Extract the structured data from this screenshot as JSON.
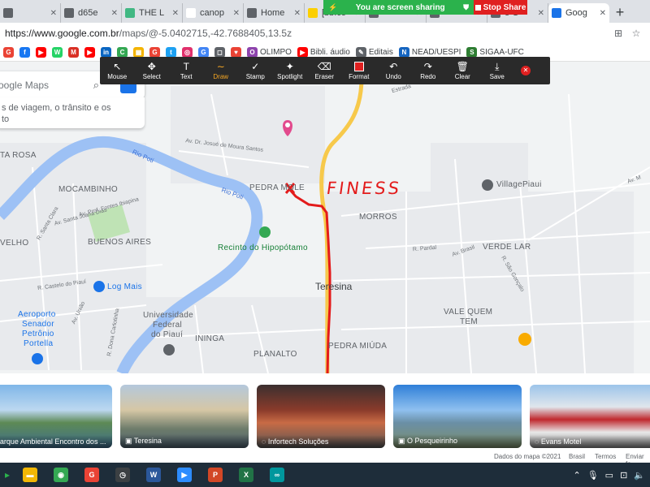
{
  "browser": {
    "tabs": [
      {
        "label": "",
        "fav": "x",
        "favColor": "#5f6368"
      },
      {
        "label": "d65e",
        "fav": "globe",
        "favColor": "#5f6368"
      },
      {
        "label": "THE L",
        "fav": "V",
        "favColor": "#41b883"
      },
      {
        "label": "canop",
        "fav": "G",
        "favColor": "#ffffff"
      },
      {
        "label": "Home",
        "fav": "hand",
        "favColor": "#5f6368"
      },
      {
        "label": "[bb.co",
        "fav": "bb",
        "favColor": "#fccf00"
      },
      {
        "label": "",
        "fav": "globe",
        "favColor": "#5f6368"
      },
      {
        "label": "",
        "fav": "globe",
        "favColor": "#5f6368"
      },
      {
        "label": "e G",
        "fav": "",
        "favColor": "#5f6368"
      },
      {
        "label": "Goog",
        "fav": "pin",
        "favColor": "#1a73e8",
        "active": true
      }
    ],
    "new_tab": "+",
    "url_host": "https://www.google.com.br",
    "url_rest": "/maps/@-5.0402715,-42.7688405,13.5z",
    "bookmarks": [
      {
        "label": "",
        "icon": "G",
        "color": "#ea4335"
      },
      {
        "label": "",
        "icon": "f",
        "color": "#1877f2"
      },
      {
        "label": "",
        "icon": "▶",
        "color": "#ff0000"
      },
      {
        "label": "",
        "icon": "W",
        "color": "#25d366"
      },
      {
        "label": "",
        "icon": "M",
        "color": "#d93025"
      },
      {
        "label": "",
        "icon": "▶",
        "color": "#ff0000"
      },
      {
        "label": "",
        "icon": "in",
        "color": "#0a66c2"
      },
      {
        "label": "",
        "icon": "C",
        "color": "#34a853"
      },
      {
        "label": "",
        "icon": "▦",
        "color": "#f4b400"
      },
      {
        "label": "",
        "icon": "G",
        "color": "#ea4335"
      },
      {
        "label": "",
        "icon": "t",
        "color": "#1da1f2"
      },
      {
        "label": "",
        "icon": "◎",
        "color": "#e1306c"
      },
      {
        "label": "",
        "icon": "G",
        "color": "#4285f4"
      },
      {
        "label": "",
        "icon": "◻",
        "color": "#5f6368"
      },
      {
        "label": "",
        "icon": "♥",
        "color": "#ea4335"
      },
      {
        "label": "OLIMPO",
        "icon": "O",
        "color": "#8e44ad"
      },
      {
        "label": "Bibli. áudio",
        "icon": "▶",
        "color": "#ff0000"
      },
      {
        "label": "Editais",
        "icon": "✎",
        "color": "#5f6368"
      },
      {
        "label": "NEAD/UESPI",
        "icon": "N",
        "color": "#1565c0"
      },
      {
        "label": "SIGAA-UFC",
        "icon": "S",
        "color": "#2e7d32"
      }
    ]
  },
  "share_banner": {
    "sharing_text": "You are screen sharing",
    "stop_label": "Stop Share"
  },
  "zoom_toolbar": {
    "tools": [
      {
        "label": "Mouse",
        "icon": "↖"
      },
      {
        "label": "Select",
        "icon": "✥"
      },
      {
        "label": "Text",
        "icon": "T"
      },
      {
        "label": "Draw",
        "icon": "∼",
        "selected": true
      },
      {
        "label": "Stamp",
        "icon": "✓"
      },
      {
        "label": "Spotlight",
        "icon": "✦"
      },
      {
        "label": "Eraser",
        "icon": "⌫"
      },
      {
        "label": "Format",
        "icon": "fmt"
      },
      {
        "label": "Undo",
        "icon": "↶"
      },
      {
        "label": "Redo",
        "icon": "↷"
      },
      {
        "label": "Clear",
        "icon": "🗑"
      },
      {
        "label": "Save",
        "icon": "⤓"
      }
    ],
    "accent": "#f5a623"
  },
  "maps": {
    "search_placeholder": "oogle Maps",
    "suggest_line1": "s de viagem, o trânsito e os",
    "suggest_line2": "to",
    "places": {
      "santa_rosa": "TA ROSA",
      "mocambinho": "MOCAMBINHO",
      "buenos_aires": "BUENOS AIRES",
      "velho": "VELHO",
      "pedra_mole": "PEDRA MOLE",
      "morros": "MORROS",
      "verde_lar": "VERDE LAR",
      "teresina": "Teresina",
      "vale_quem_tem_1": "VALE QUEM",
      "vale_quem_tem_2": "TEM",
      "ininga": "ININGA",
      "planalto": "PLANALTO",
      "pedra_miuda": "PEDRA MIÚDA",
      "ufpi_1": "Universidade",
      "ufpi_2": "Federal",
      "ufpi_3": "do Piauí",
      "airport_1": "Aeroporto",
      "airport_2": "Senador",
      "airport_3": "Petrônio",
      "airport_4": "Portella",
      "log_mais": "Log Mais",
      "village_piaui": "VillagePiaui",
      "hipopotamo": "Recinto do Hipopótamo",
      "rio_poti_1": "Rio Poti",
      "rio_poti_2": "Rio Poti"
    },
    "roads": {
      "r1": "Av. Dr. Josué de Moura Santos",
      "r2": "Av. Prof. Fontes Ibiapina",
      "r3": "R. Santa Clara",
      "r4": "Av. Santa Joana Dias",
      "r5": "R. Castelo do Piauí",
      "r6": "Av. União",
      "r7": "R. Dona Carlotinha",
      "r8": "R. Pardal",
      "r9": "Av. Brasil",
      "r10": "R. São Gonçalo",
      "r11": "Estrada",
      "r12": "Av. M"
    },
    "annotation_text": "FINESS",
    "annotation_color": "#e31b1b",
    "river_color": "#9dc1f5",
    "highway_color": "#f7c94b"
  },
  "photos": [
    {
      "caption": "Parque Ambiental Encontro dos ...",
      "icon": "pano"
    },
    {
      "caption": "Teresina",
      "icon": "camera"
    },
    {
      "caption": "Infortech Soluções",
      "icon": "pano"
    },
    {
      "caption": "O Pesqueirinho",
      "icon": "camera"
    },
    {
      "caption": "Evans Motel",
      "icon": "pano"
    }
  ],
  "footer": {
    "copyright": "Dados do mapa ©2021",
    "country": "Brasil",
    "terms": "Termos",
    "feedback": "Enviar fe"
  },
  "taskbar": {
    "apps": [
      {
        "icon": "folder",
        "color": "#f2b705",
        "glyph": "▬"
      },
      {
        "icon": "chrome",
        "color": "#34a853",
        "glyph": "◉"
      },
      {
        "icon": "g-app",
        "color": "#ea4335",
        "glyph": "G"
      },
      {
        "icon": "clock",
        "color": "#3c4043",
        "glyph": "◷"
      },
      {
        "icon": "word",
        "color": "#2b579a",
        "glyph": "W"
      },
      {
        "icon": "zoom",
        "color": "#2d8cff",
        "glyph": "▶"
      },
      {
        "icon": "powerpoint",
        "color": "#d24726",
        "glyph": "P"
      },
      {
        "icon": "excel",
        "color": "#217346",
        "glyph": "X"
      },
      {
        "icon": "arduino",
        "color": "#00979d",
        "glyph": "∞"
      }
    ]
  }
}
